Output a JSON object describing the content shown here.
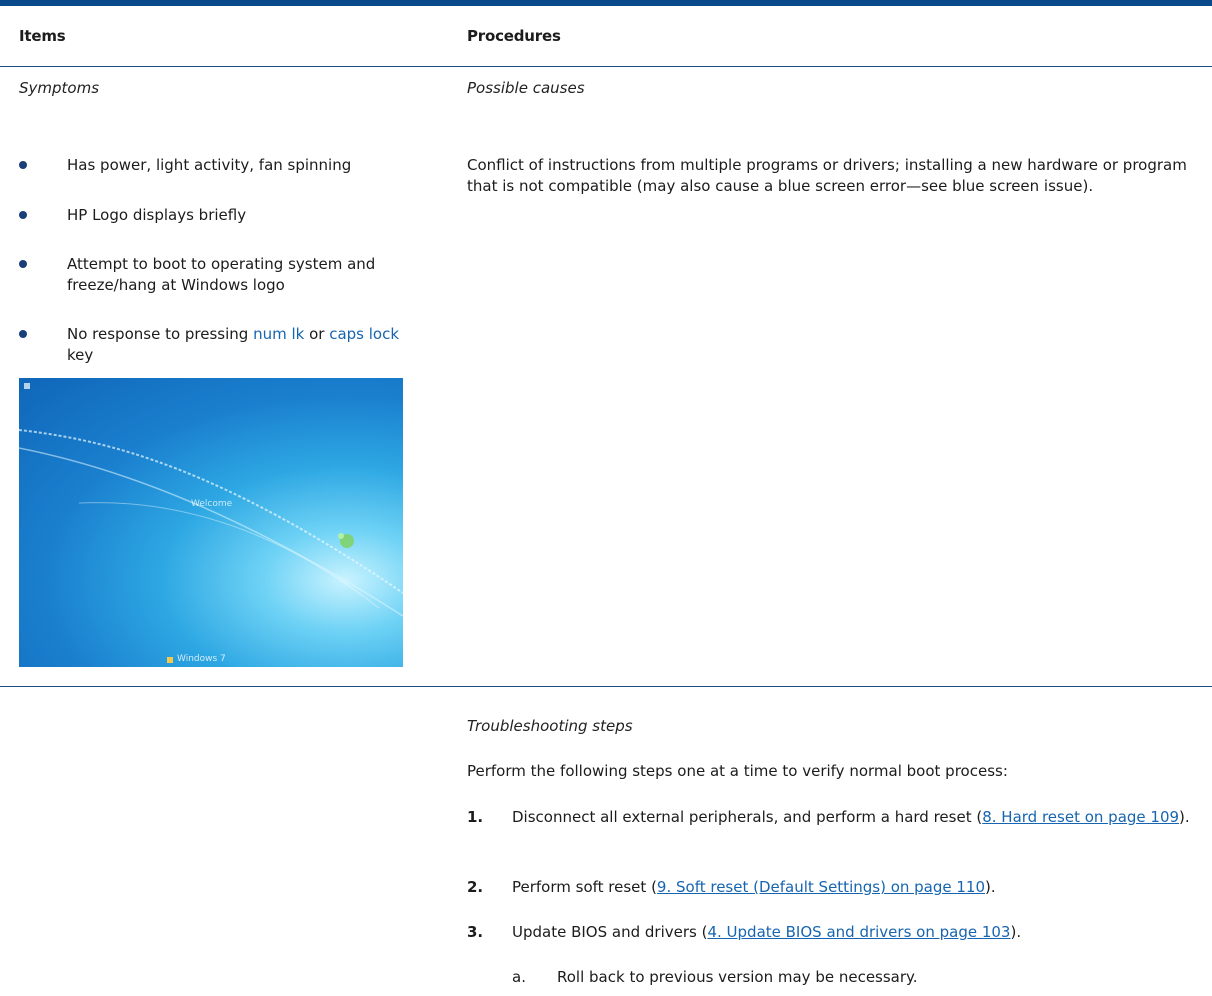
{
  "header": {
    "items": "Items",
    "procedures": "Procedures"
  },
  "symptoms_heading": "Symptoms",
  "causes_heading": "Possible causes",
  "symptoms": [
    "Has power, light activity, fan spinning",
    "HP Logo displays briefly",
    "Attempt to boot to operating system and freeze/hang at Windows logo"
  ],
  "symptom4": {
    "pre": "No response to pressing ",
    "key1": "num lk",
    "mid": " or ",
    "key2": "caps lock",
    "post": " key"
  },
  "causes_text": "Conflict of instructions from multiple programs or drivers; installing a new hardware or program that is not compatible (may also cause a blue screen error—see blue screen issue).",
  "screenshot": {
    "welcome": "Welcome",
    "brand": "Windows 7"
  },
  "troubleshooting_heading": "Troubleshooting steps",
  "intro": "Perform the following steps one at a time to verify normal boot process:",
  "steps": [
    {
      "num": "1.",
      "pre": "Disconnect all external peripherals, and perform a hard reset (",
      "link": "8. Hard reset on page 109",
      "post": ")."
    },
    {
      "num": "2.",
      "pre": "Perform soft reset (",
      "link": "9. Soft reset (Default Settings) on page 110",
      "post": ")."
    },
    {
      "num": "3.",
      "pre": "Update BIOS and drivers (",
      "link": "4. Update BIOS and drivers on page 103",
      "post": ")."
    }
  ],
  "substep": {
    "letter": "a.",
    "text": "Roll back to previous version may be necessary."
  },
  "colors": {
    "rule": "#0a4a8a",
    "link": "#1765b0",
    "bullet": "#1a3e79"
  }
}
